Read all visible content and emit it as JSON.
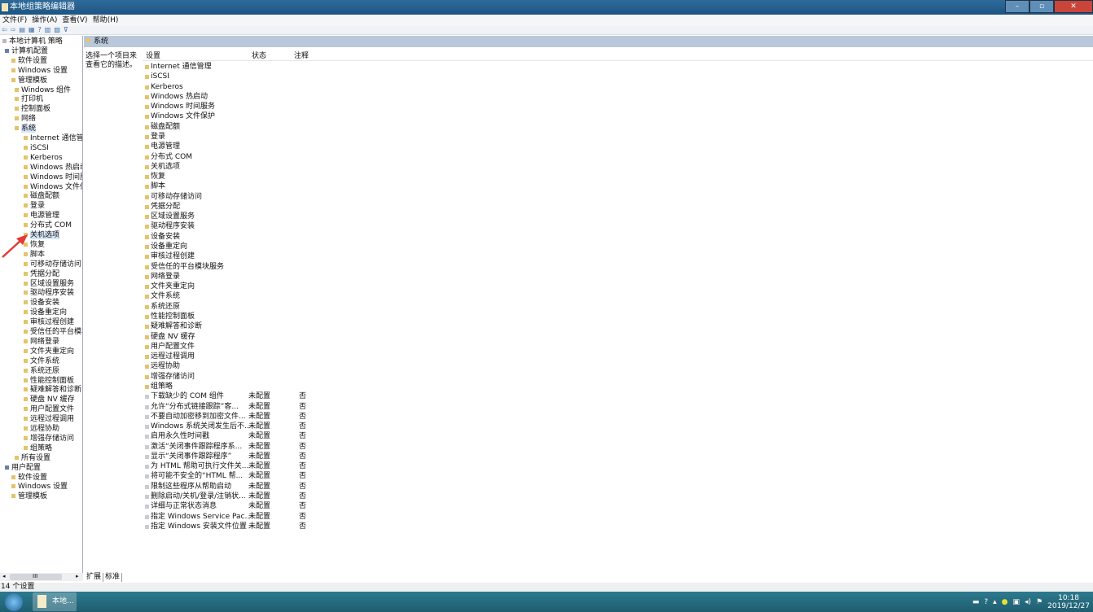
{
  "window": {
    "title": "本地组策略编辑器",
    "buttons": [
      "–",
      "▫",
      "✕"
    ]
  },
  "menu": [
    "文件(F)",
    "操作(A)",
    "查看(V)",
    "帮助(H)"
  ],
  "toolbar": [
    "⇦",
    "⇨",
    "▤",
    "▦",
    "?",
    "▥",
    "▧",
    "⊽"
  ],
  "tree": [
    {
      "label": "本地计算机 策略",
      "level": 0
    },
    {
      "label": "计算机配置",
      "level": 1
    },
    {
      "label": "软件设置",
      "level": 2
    },
    {
      "label": "Windows 设置",
      "level": 2
    },
    {
      "label": "管理模板",
      "level": 2
    },
    {
      "label": "Windows 组件",
      "level": 3
    },
    {
      "label": "打印机",
      "level": 3
    },
    {
      "label": "控制面板",
      "level": 3
    },
    {
      "label": "网络",
      "level": 3
    },
    {
      "label": "系统",
      "level": 3,
      "selected": true
    },
    {
      "label": "Internet 通信管理",
      "level": 4
    },
    {
      "label": "iSCSI",
      "level": 4
    },
    {
      "label": "Kerberos",
      "level": 4
    },
    {
      "label": "Windows 热启动",
      "level": 4
    },
    {
      "label": "Windows 时间服务",
      "level": 4
    },
    {
      "label": "Windows 文件保护",
      "level": 4
    },
    {
      "label": "磁盘配额",
      "level": 4
    },
    {
      "label": "登录",
      "level": 4
    },
    {
      "label": "电源管理",
      "level": 4
    },
    {
      "label": "分布式 COM",
      "level": 4
    },
    {
      "label": "关机选项",
      "level": 4,
      "hover": true
    },
    {
      "label": "恢复",
      "level": 4
    },
    {
      "label": "脚本",
      "level": 4
    },
    {
      "label": "可移动存储访问",
      "level": 4
    },
    {
      "label": "凭据分配",
      "level": 4
    },
    {
      "label": "区域设置服务",
      "level": 4
    },
    {
      "label": "驱动程序安装",
      "level": 4
    },
    {
      "label": "设备安装",
      "level": 4
    },
    {
      "label": "设备重定向",
      "level": 4
    },
    {
      "label": "审核过程创建",
      "level": 4
    },
    {
      "label": "受信任的平台模块服务",
      "level": 4
    },
    {
      "label": "网络登录",
      "level": 4
    },
    {
      "label": "文件夹重定向",
      "level": 4
    },
    {
      "label": "文件系统",
      "level": 4
    },
    {
      "label": "系统还原",
      "level": 4
    },
    {
      "label": "性能控制面板",
      "level": 4
    },
    {
      "label": "疑难解答和诊断",
      "level": 4
    },
    {
      "label": "硬盘 NV 缓存",
      "level": 4
    },
    {
      "label": "用户配置文件",
      "level": 4
    },
    {
      "label": "远程过程调用",
      "level": 4
    },
    {
      "label": "远程协助",
      "level": 4
    },
    {
      "label": "增强存储访问",
      "level": 4
    },
    {
      "label": "组策略",
      "level": 4
    },
    {
      "label": "所有设置",
      "level": 3
    },
    {
      "label": "用户配置",
      "level": 1
    },
    {
      "label": "软件设置",
      "level": 2
    },
    {
      "label": "Windows 设置",
      "level": 2
    },
    {
      "label": "管理模板",
      "level": 2
    }
  ],
  "right": {
    "header": "系统",
    "description": "选择一个项目来查看它的描述。",
    "columns": [
      "设置",
      "状态",
      "注释"
    ],
    "folders": [
      "Internet 通信管理",
      "iSCSI",
      "Kerberos",
      "Windows 热启动",
      "Windows 时间服务",
      "Windows 文件保护",
      "磁盘配额",
      "登录",
      "电源管理",
      "分布式 COM",
      "关机选项",
      "恢复",
      "脚本",
      "可移动存储访问",
      "凭据分配",
      "区域设置服务",
      "驱动程序安装",
      "设备安装",
      "设备重定向",
      "审核过程创建",
      "受信任的平台模块服务",
      "网络登录",
      "文件夹重定向",
      "文件系统",
      "系统还原",
      "性能控制面板",
      "疑难解答和诊断",
      "硬盘 NV 缓存",
      "用户配置文件",
      "远程过程调用",
      "远程协助",
      "增强存储访问",
      "组策略"
    ],
    "settings": [
      {
        "name": "下载缺少的 COM 组件",
        "state": "未配置",
        "note": "否"
      },
      {
        "name": "允许“分布式链接跟踪”客...",
        "state": "未配置",
        "note": "否"
      },
      {
        "name": "不要自动加密移到加密文件...",
        "state": "未配置",
        "note": "否"
      },
      {
        "name": "Windows 系统关闭发生后不...",
        "state": "未配置",
        "note": "否"
      },
      {
        "name": "启用永久性时间戳",
        "state": "未配置",
        "note": "否"
      },
      {
        "name": "激活“关闭事件跟踪程序系...",
        "state": "未配置",
        "note": "否"
      },
      {
        "name": "显示“关闭事件跟踪程序”",
        "state": "未配置",
        "note": "否"
      },
      {
        "name": "为 HTML 帮助可执行文件关...",
        "state": "未配置",
        "note": "否"
      },
      {
        "name": "将可能不安全的“HTML 帮...",
        "state": "未配置",
        "note": "否"
      },
      {
        "name": "限制这些程序从帮助启动",
        "state": "未配置",
        "note": "否"
      },
      {
        "name": "删除启动/关机/登录/注销状...",
        "state": "未配置",
        "note": "否"
      },
      {
        "name": "详细与正常状态消息",
        "state": "未配置",
        "note": "否"
      },
      {
        "name": "指定 Windows Service Pac...",
        "state": "未配置",
        "note": "否"
      },
      {
        "name": "指定 Windows 安装文件位置",
        "state": "未配置",
        "note": "否"
      }
    ]
  },
  "tabs": [
    "扩展",
    "标准"
  ],
  "scrollbar": {
    "left": "◂",
    "thumb": "III",
    "right": "▸"
  },
  "status": "14 个设置",
  "taskbar": {
    "task": "本地...",
    "time": "10:18",
    "date": "2019/12/27"
  },
  "colors": {
    "title": "#1d5584",
    "selection": "#d7e6f7",
    "folder": "#e3c46a",
    "annotation_arrow": "#e53935"
  }
}
